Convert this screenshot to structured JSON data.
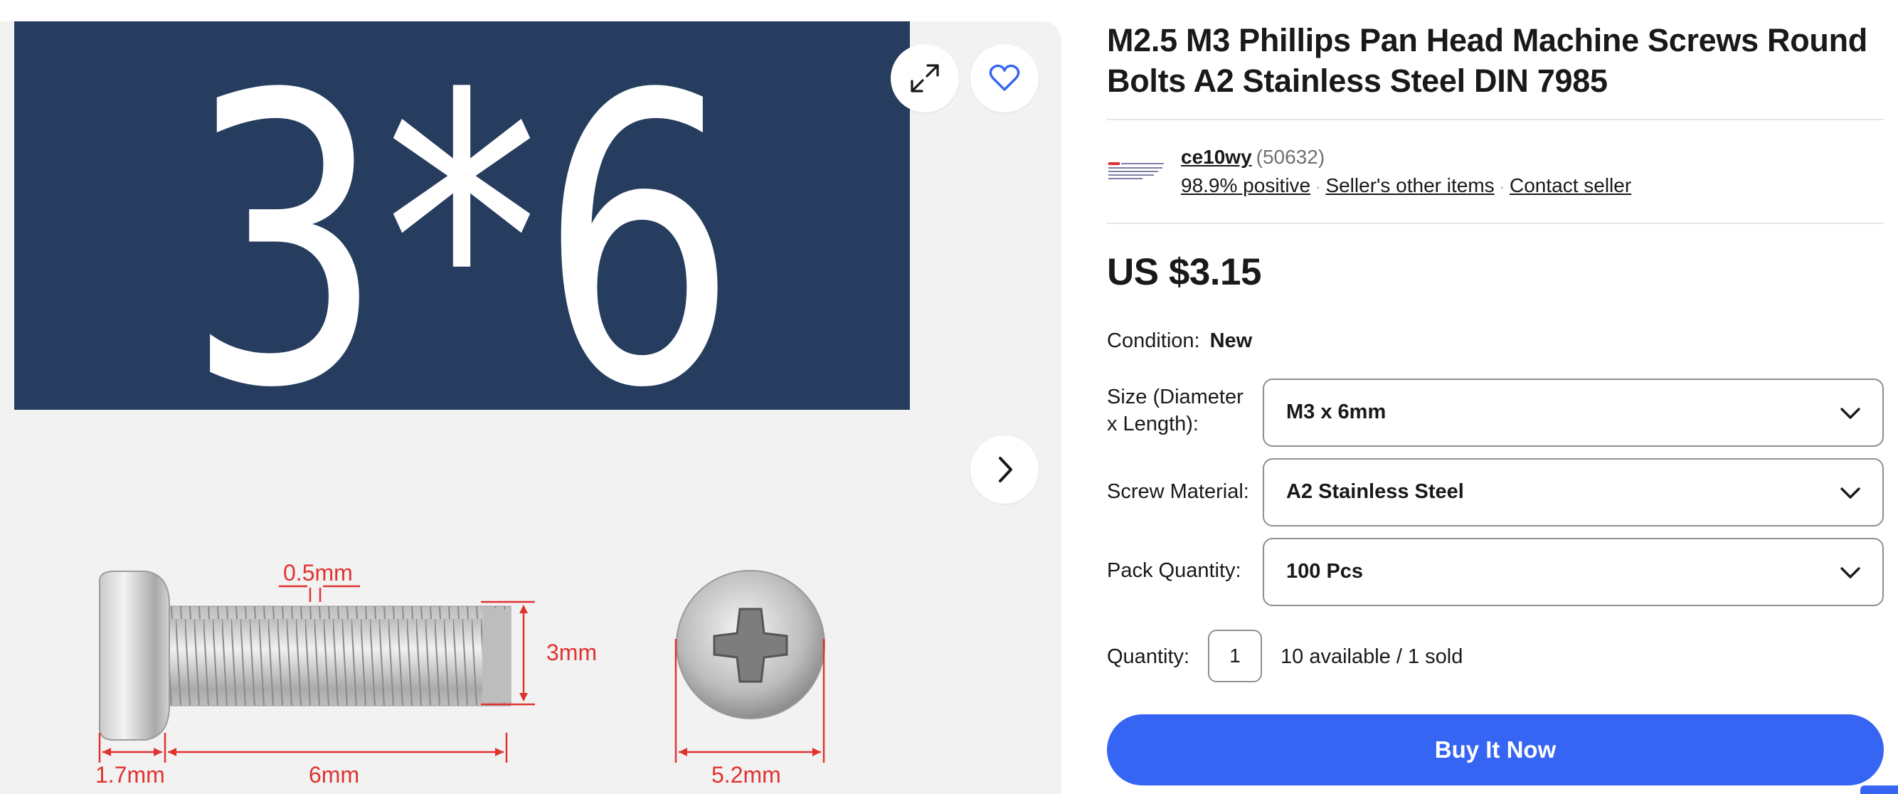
{
  "gallery": {
    "hero_text": "3*6",
    "dimensions": {
      "pitch": "0.5mm",
      "diameter": "3mm",
      "head_height": "1.7mm",
      "length": "6mm",
      "head_diameter": "5.2mm"
    },
    "icons": {
      "expand": "expand-icon",
      "watch": "heart-icon",
      "next": "chevron-right-icon"
    }
  },
  "listing": {
    "title": "M2.5 M3 Phillips Pan Head Machine Screws Round Bolts A2 Stainless Steel DIN 7985",
    "seller": {
      "name": "ce10wy",
      "feedback_count": "(50632)",
      "positive": "98.9% positive",
      "other_items": "Seller's other items",
      "contact": "Contact seller"
    },
    "price": "US $3.15",
    "condition": {
      "label": "Condition:",
      "value": "New"
    },
    "options": [
      {
        "label": "Size (Diameter x Length):",
        "value": "M3 x 6mm"
      },
      {
        "label": "Screw Material:",
        "value": "A2 Stainless Steel"
      },
      {
        "label": "Pack Quantity:",
        "value": "100 Pcs"
      }
    ],
    "quantity": {
      "label": "Quantity:",
      "value": "1",
      "availability": "10 available / 1 sold"
    },
    "buy_now_label": "Buy It Now"
  },
  "colors": {
    "accent": "#3665f3",
    "hero_bg": "#263d5f",
    "dimension_red": "#e0332f"
  }
}
